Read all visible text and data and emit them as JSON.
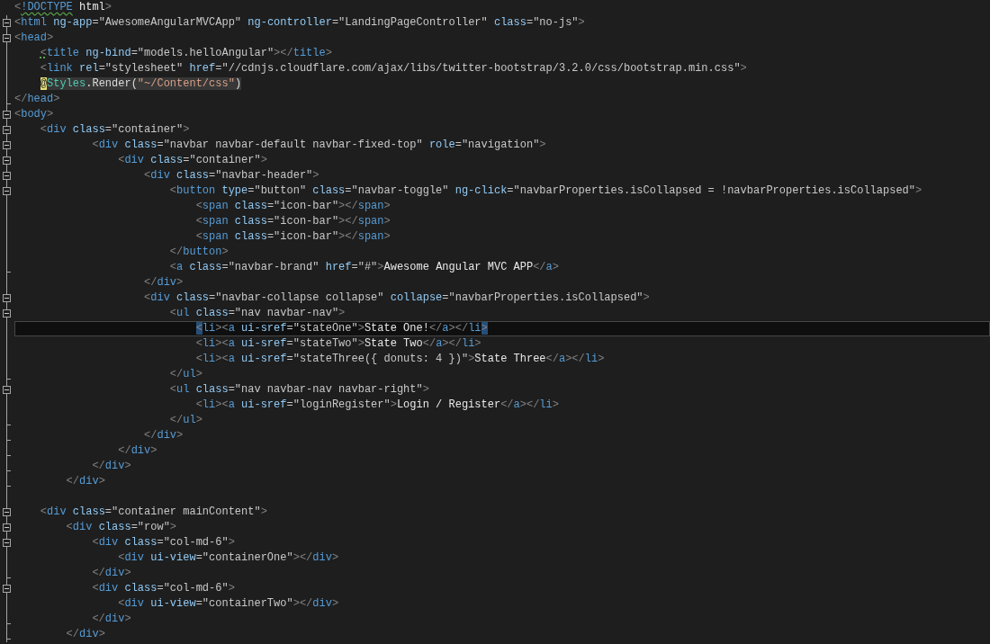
{
  "editor": {
    "lines": [
      {
        "kind": "plain",
        "current": false,
        "tokens": [
          {
            "kind": "punct",
            "text": "<"
          },
          {
            "kind": "tag",
            "text": "!DOCTYPE",
            "wavy_underline": true
          },
          {
            "kind": "text",
            "text": " html"
          },
          {
            "kind": "punct",
            "text": ">"
          }
        ]
      },
      {
        "kind": "start",
        "current": false,
        "tokens": [
          {
            "kind": "punct",
            "text": "<"
          },
          {
            "kind": "tag",
            "text": "html"
          },
          {
            "kind": "attr",
            "text": " ng-app"
          },
          {
            "kind": "value",
            "text": "=\"AwesomeAngularMVCApp\""
          },
          {
            "kind": "attr",
            "text": " ng-controller"
          },
          {
            "kind": "value",
            "text": "=\"LandingPageController\""
          },
          {
            "kind": "attr",
            "text": " class"
          },
          {
            "kind": "value",
            "text": "=\"no-js\""
          },
          {
            "kind": "punct",
            "text": ">"
          }
        ]
      },
      {
        "kind": "start",
        "current": false,
        "tokens": [
          {
            "kind": "punct",
            "text": "<"
          },
          {
            "kind": "tag",
            "text": "head"
          },
          {
            "kind": "punct",
            "text": ">"
          }
        ]
      },
      {
        "kind": "inner",
        "current": false,
        "tokens": [
          {
            "kind": "punct",
            "text": "    <",
            "dotted_underline": true
          },
          {
            "kind": "tag",
            "text": "title"
          },
          {
            "kind": "attr",
            "text": " ng-bind"
          },
          {
            "kind": "value",
            "text": "=\"models.helloAngular\""
          },
          {
            "kind": "punct",
            "text": "></"
          },
          {
            "kind": "tag",
            "text": "title"
          },
          {
            "kind": "punct",
            "text": ">"
          }
        ]
      },
      {
        "kind": "inner",
        "current": false,
        "tokens": [
          {
            "kind": "punct",
            "text": "    <"
          },
          {
            "kind": "tag",
            "text": "link"
          },
          {
            "kind": "attr",
            "text": " rel"
          },
          {
            "kind": "value",
            "text": "=\"stylesheet\""
          },
          {
            "kind": "attr",
            "text": " href"
          },
          {
            "kind": "value",
            "text": "=\"//cdnjs.cloudflare.com/ajax/libs/twitter-bootstrap/3.2.0/css/bootstrap.min.css\""
          },
          {
            "kind": "punct",
            "text": ">"
          }
        ]
      },
      {
        "kind": "inner",
        "current": false,
        "tokens": [
          {
            "kind": "razor-at",
            "text": "    @"
          },
          {
            "kind": "razor-type",
            "text": "Styles"
          },
          {
            "kind": "razor-text",
            "text": ".Render("
          },
          {
            "kind": "razor-string",
            "text": "\"~/Content/css\""
          },
          {
            "kind": "razor-text",
            "text": ")"
          }
        ]
      },
      {
        "kind": "end",
        "current": false,
        "tokens": [
          {
            "kind": "punct",
            "text": "</"
          },
          {
            "kind": "tag",
            "text": "head"
          },
          {
            "kind": "punct",
            "text": ">"
          }
        ]
      },
      {
        "kind": "start",
        "current": false,
        "tokens": [
          {
            "kind": "punct",
            "text": "<"
          },
          {
            "kind": "tag",
            "text": "body"
          },
          {
            "kind": "punct",
            "text": ">"
          }
        ]
      },
      {
        "kind": "start",
        "current": false,
        "tokens": [
          {
            "kind": "punct",
            "text": "    <"
          },
          {
            "kind": "tag",
            "text": "div"
          },
          {
            "kind": "attr",
            "text": " class"
          },
          {
            "kind": "value",
            "text": "=\"container\""
          },
          {
            "kind": "punct",
            "text": ">"
          }
        ]
      },
      {
        "kind": "start",
        "current": false,
        "tokens": [
          {
            "kind": "punct",
            "text": "            <"
          },
          {
            "kind": "tag",
            "text": "div"
          },
          {
            "kind": "attr",
            "text": " class"
          },
          {
            "kind": "value",
            "text": "=\"navbar navbar-default navbar-fixed-top\""
          },
          {
            "kind": "attr",
            "text": " role"
          },
          {
            "kind": "value",
            "text": "=\"navigation\""
          },
          {
            "kind": "punct",
            "text": ">"
          }
        ]
      },
      {
        "kind": "start",
        "current": false,
        "tokens": [
          {
            "kind": "punct",
            "text": "                <"
          },
          {
            "kind": "tag",
            "text": "div"
          },
          {
            "kind": "attr",
            "text": " class"
          },
          {
            "kind": "value",
            "text": "=\"container\""
          },
          {
            "kind": "punct",
            "text": ">"
          }
        ]
      },
      {
        "kind": "start",
        "current": false,
        "tokens": [
          {
            "kind": "punct",
            "text": "                    <"
          },
          {
            "kind": "tag",
            "text": "div"
          },
          {
            "kind": "attr",
            "text": " class"
          },
          {
            "kind": "value",
            "text": "=\"navbar-header\""
          },
          {
            "kind": "punct",
            "text": ">"
          }
        ]
      },
      {
        "kind": "start",
        "current": false,
        "tokens": [
          {
            "kind": "punct",
            "text": "                        <"
          },
          {
            "kind": "tag",
            "text": "button"
          },
          {
            "kind": "attr",
            "text": " type"
          },
          {
            "kind": "value",
            "text": "=\"button\""
          },
          {
            "kind": "attr",
            "text": " class"
          },
          {
            "kind": "value",
            "text": "=\"navbar-toggle\""
          },
          {
            "kind": "attr",
            "text": " ng-click"
          },
          {
            "kind": "value",
            "text": "=\"navbarProperties.isCollapsed = !navbarProperties.isCollapsed\""
          },
          {
            "kind": "punct",
            "text": ">"
          }
        ]
      },
      {
        "kind": "inner",
        "current": false,
        "tokens": [
          {
            "kind": "punct",
            "text": "                            <"
          },
          {
            "kind": "tag",
            "text": "span"
          },
          {
            "kind": "attr",
            "text": " class"
          },
          {
            "kind": "value",
            "text": "=\"icon-bar\""
          },
          {
            "kind": "punct",
            "text": "></"
          },
          {
            "kind": "tag",
            "text": "span"
          },
          {
            "kind": "punct",
            "text": ">"
          }
        ]
      },
      {
        "kind": "inner",
        "current": false,
        "tokens": [
          {
            "kind": "punct",
            "text": "                            <"
          },
          {
            "kind": "tag",
            "text": "span"
          },
          {
            "kind": "attr",
            "text": " class"
          },
          {
            "kind": "value",
            "text": "=\"icon-bar\""
          },
          {
            "kind": "punct",
            "text": "></"
          },
          {
            "kind": "tag",
            "text": "span"
          },
          {
            "kind": "punct",
            "text": ">"
          }
        ]
      },
      {
        "kind": "inner",
        "current": false,
        "tokens": [
          {
            "kind": "punct",
            "text": "                            <"
          },
          {
            "kind": "tag",
            "text": "span"
          },
          {
            "kind": "attr",
            "text": " class"
          },
          {
            "kind": "value",
            "text": "=\"icon-bar\""
          },
          {
            "kind": "punct",
            "text": "></"
          },
          {
            "kind": "tag",
            "text": "span"
          },
          {
            "kind": "punct",
            "text": ">"
          }
        ]
      },
      {
        "kind": "inner",
        "current": false,
        "tokens": [
          {
            "kind": "punct",
            "text": "                        </"
          },
          {
            "kind": "tag",
            "text": "button"
          },
          {
            "kind": "punct",
            "text": ">"
          }
        ]
      },
      {
        "kind": "end",
        "current": false,
        "tokens": [
          {
            "kind": "punct",
            "text": "                        <"
          },
          {
            "kind": "tag",
            "text": "a"
          },
          {
            "kind": "attr",
            "text": " class"
          },
          {
            "kind": "value",
            "text": "=\"navbar-brand\""
          },
          {
            "kind": "attr",
            "text": " href"
          },
          {
            "kind": "value",
            "text": "=\"#\""
          },
          {
            "kind": "punct",
            "text": ">"
          },
          {
            "kind": "text",
            "text": "Awesome Angular MVC APP"
          },
          {
            "kind": "punct",
            "text": "</"
          },
          {
            "kind": "tag",
            "text": "a"
          },
          {
            "kind": "punct",
            "text": ">"
          }
        ]
      },
      {
        "kind": "inner",
        "current": false,
        "tokens": [
          {
            "kind": "punct",
            "text": "                    </"
          },
          {
            "kind": "tag",
            "text": "div"
          },
          {
            "kind": "punct",
            "text": ">"
          }
        ]
      },
      {
        "kind": "start",
        "current": false,
        "tokens": [
          {
            "kind": "punct",
            "text": "                    <"
          },
          {
            "kind": "tag",
            "text": "div"
          },
          {
            "kind": "attr",
            "text": " class"
          },
          {
            "kind": "value",
            "text": "=\"navbar-collapse collapse\""
          },
          {
            "kind": "attr",
            "text": " collapse"
          },
          {
            "kind": "value",
            "text": "=\"navbarProperties.isCollapsed\""
          },
          {
            "kind": "punct",
            "text": ">"
          }
        ]
      },
      {
        "kind": "start",
        "current": false,
        "tokens": [
          {
            "kind": "punct",
            "text": "                        <"
          },
          {
            "kind": "tag",
            "text": "ul"
          },
          {
            "kind": "attr",
            "text": " class"
          },
          {
            "kind": "value",
            "text": "=\"nav navbar-nav\""
          },
          {
            "kind": "punct",
            "text": ">"
          }
        ]
      },
      {
        "kind": "inner",
        "current": true,
        "tokens": [
          {
            "kind": "brace",
            "text": "                            <"
          },
          {
            "kind": "tag",
            "text": "li"
          },
          {
            "kind": "punct",
            "text": "><"
          },
          {
            "kind": "tag",
            "text": "a"
          },
          {
            "kind": "attr",
            "text": " ui-sref"
          },
          {
            "kind": "value",
            "text": "=\"stateOne\""
          },
          {
            "kind": "punct",
            "text": ">"
          },
          {
            "kind": "text",
            "text": "State One!"
          },
          {
            "kind": "punct",
            "text": "</"
          },
          {
            "kind": "tag",
            "text": "a"
          },
          {
            "kind": "punct",
            "text": "></"
          },
          {
            "kind": "tag",
            "text": "li"
          },
          {
            "kind": "brace",
            "text": ">"
          }
        ]
      },
      {
        "kind": "inner",
        "current": false,
        "tokens": [
          {
            "kind": "punct",
            "text": "                            <"
          },
          {
            "kind": "tag",
            "text": "li"
          },
          {
            "kind": "punct",
            "text": "><"
          },
          {
            "kind": "tag",
            "text": "a"
          },
          {
            "kind": "attr",
            "text": " ui-sref"
          },
          {
            "kind": "value",
            "text": "=\"stateTwo\""
          },
          {
            "kind": "punct",
            "text": ">"
          },
          {
            "kind": "text",
            "text": "State Two"
          },
          {
            "kind": "punct",
            "text": "</"
          },
          {
            "kind": "tag",
            "text": "a"
          },
          {
            "kind": "punct",
            "text": "></"
          },
          {
            "kind": "tag",
            "text": "li"
          },
          {
            "kind": "punct",
            "text": ">"
          }
        ]
      },
      {
        "kind": "inner",
        "current": false,
        "tokens": [
          {
            "kind": "punct",
            "text": "                            <"
          },
          {
            "kind": "tag",
            "text": "li"
          },
          {
            "kind": "punct",
            "text": "><"
          },
          {
            "kind": "tag",
            "text": "a"
          },
          {
            "kind": "attr",
            "text": " ui-sref"
          },
          {
            "kind": "value",
            "text": "=\"stateThree({ donuts: 4 })\""
          },
          {
            "kind": "punct",
            "text": ">"
          },
          {
            "kind": "text",
            "text": "State Three"
          },
          {
            "kind": "punct",
            "text": "</"
          },
          {
            "kind": "tag",
            "text": "a"
          },
          {
            "kind": "punct",
            "text": "></"
          },
          {
            "kind": "tag",
            "text": "li"
          },
          {
            "kind": "punct",
            "text": ">"
          }
        ]
      },
      {
        "kind": "end",
        "current": false,
        "tokens": [
          {
            "kind": "punct",
            "text": "                        </"
          },
          {
            "kind": "tag",
            "text": "ul"
          },
          {
            "kind": "punct",
            "text": ">"
          }
        ]
      },
      {
        "kind": "start",
        "current": false,
        "tokens": [
          {
            "kind": "punct",
            "text": "                        <"
          },
          {
            "kind": "tag",
            "text": "ul"
          },
          {
            "kind": "attr",
            "text": " class"
          },
          {
            "kind": "value",
            "text": "=\"nav navbar-nav navbar-right\""
          },
          {
            "kind": "punct",
            "text": ">"
          }
        ]
      },
      {
        "kind": "inner",
        "current": false,
        "tokens": [
          {
            "kind": "punct",
            "text": "                            <"
          },
          {
            "kind": "tag",
            "text": "li"
          },
          {
            "kind": "punct",
            "text": "><"
          },
          {
            "kind": "tag",
            "text": "a"
          },
          {
            "kind": "attr",
            "text": " ui-sref"
          },
          {
            "kind": "value",
            "text": "=\"loginRegister\""
          },
          {
            "kind": "punct",
            "text": ">"
          },
          {
            "kind": "text",
            "text": "Login / Register"
          },
          {
            "kind": "punct",
            "text": "</"
          },
          {
            "kind": "tag",
            "text": "a"
          },
          {
            "kind": "punct",
            "text": "></"
          },
          {
            "kind": "tag",
            "text": "li"
          },
          {
            "kind": "punct",
            "text": ">"
          }
        ]
      },
      {
        "kind": "end",
        "current": false,
        "tokens": [
          {
            "kind": "punct",
            "text": "                        </"
          },
          {
            "kind": "tag",
            "text": "ul"
          },
          {
            "kind": "punct",
            "text": ">"
          }
        ]
      },
      {
        "kind": "end",
        "current": false,
        "tokens": [
          {
            "kind": "punct",
            "text": "                    </"
          },
          {
            "kind": "tag",
            "text": "div"
          },
          {
            "kind": "punct",
            "text": ">"
          }
        ]
      },
      {
        "kind": "end",
        "current": false,
        "tokens": [
          {
            "kind": "punct",
            "text": "                </"
          },
          {
            "kind": "tag",
            "text": "div"
          },
          {
            "kind": "punct",
            "text": ">"
          }
        ]
      },
      {
        "kind": "end",
        "current": false,
        "tokens": [
          {
            "kind": "punct",
            "text": "            </"
          },
          {
            "kind": "tag",
            "text": "div"
          },
          {
            "kind": "punct",
            "text": ">"
          }
        ]
      },
      {
        "kind": "end",
        "current": false,
        "tokens": [
          {
            "kind": "punct",
            "text": "        </"
          },
          {
            "kind": "tag",
            "text": "div"
          },
          {
            "kind": "punct",
            "text": ">"
          }
        ]
      },
      {
        "kind": "inner",
        "current": false
      },
      {
        "kind": "start",
        "current": false,
        "tokens": [
          {
            "kind": "punct",
            "text": "    <"
          },
          {
            "kind": "tag",
            "text": "div"
          },
          {
            "kind": "attr",
            "text": " class"
          },
          {
            "kind": "value",
            "text": "=\"container mainContent\""
          },
          {
            "kind": "punct",
            "text": ">"
          }
        ]
      },
      {
        "kind": "start",
        "current": false,
        "tokens": [
          {
            "kind": "punct",
            "text": "        <"
          },
          {
            "kind": "tag",
            "text": "div"
          },
          {
            "kind": "attr",
            "text": " class"
          },
          {
            "kind": "value",
            "text": "=\"row\""
          },
          {
            "kind": "punct",
            "text": ">"
          }
        ]
      },
      {
        "kind": "start",
        "current": false,
        "tokens": [
          {
            "kind": "punct",
            "text": "            <"
          },
          {
            "kind": "tag",
            "text": "div"
          },
          {
            "kind": "attr",
            "text": " class"
          },
          {
            "kind": "value",
            "text": "=\"col-md-6\""
          },
          {
            "kind": "punct",
            "text": ">"
          }
        ]
      },
      {
        "kind": "inner",
        "current": false,
        "tokens": [
          {
            "kind": "punct",
            "text": "                <"
          },
          {
            "kind": "tag",
            "text": "div"
          },
          {
            "kind": "attr",
            "text": " ui-view"
          },
          {
            "kind": "value",
            "text": "=\"containerOne\""
          },
          {
            "kind": "punct",
            "text": "></"
          },
          {
            "kind": "tag",
            "text": "div"
          },
          {
            "kind": "punct",
            "text": ">"
          }
        ]
      },
      {
        "kind": "end",
        "current": false,
        "tokens": [
          {
            "kind": "punct",
            "text": "            </"
          },
          {
            "kind": "tag",
            "text": "div"
          },
          {
            "kind": "punct",
            "text": ">"
          }
        ]
      },
      {
        "kind": "start",
        "current": false,
        "tokens": [
          {
            "kind": "punct",
            "text": "            <"
          },
          {
            "kind": "tag",
            "text": "div"
          },
          {
            "kind": "attr",
            "text": " class"
          },
          {
            "kind": "value",
            "text": "=\"col-md-6\""
          },
          {
            "kind": "punct",
            "text": ">"
          }
        ]
      },
      {
        "kind": "inner",
        "current": false,
        "tokens": [
          {
            "kind": "punct",
            "text": "                <"
          },
          {
            "kind": "tag",
            "text": "div"
          },
          {
            "kind": "attr",
            "text": " ui-view"
          },
          {
            "kind": "value",
            "text": "=\"containerTwo\""
          },
          {
            "kind": "punct",
            "text": "></"
          },
          {
            "kind": "tag",
            "text": "div"
          },
          {
            "kind": "punct",
            "text": ">"
          }
        ]
      },
      {
        "kind": "end",
        "current": false,
        "tokens": [
          {
            "kind": "punct",
            "text": "            </"
          },
          {
            "kind": "tag",
            "text": "div"
          },
          {
            "kind": "punct",
            "text": ">"
          }
        ]
      },
      {
        "kind": "end",
        "current": false,
        "tokens": [
          {
            "kind": "punct",
            "text": "        </"
          },
          {
            "kind": "tag",
            "text": "div"
          },
          {
            "kind": "punct",
            "text": ">"
          }
        ]
      }
    ]
  }
}
